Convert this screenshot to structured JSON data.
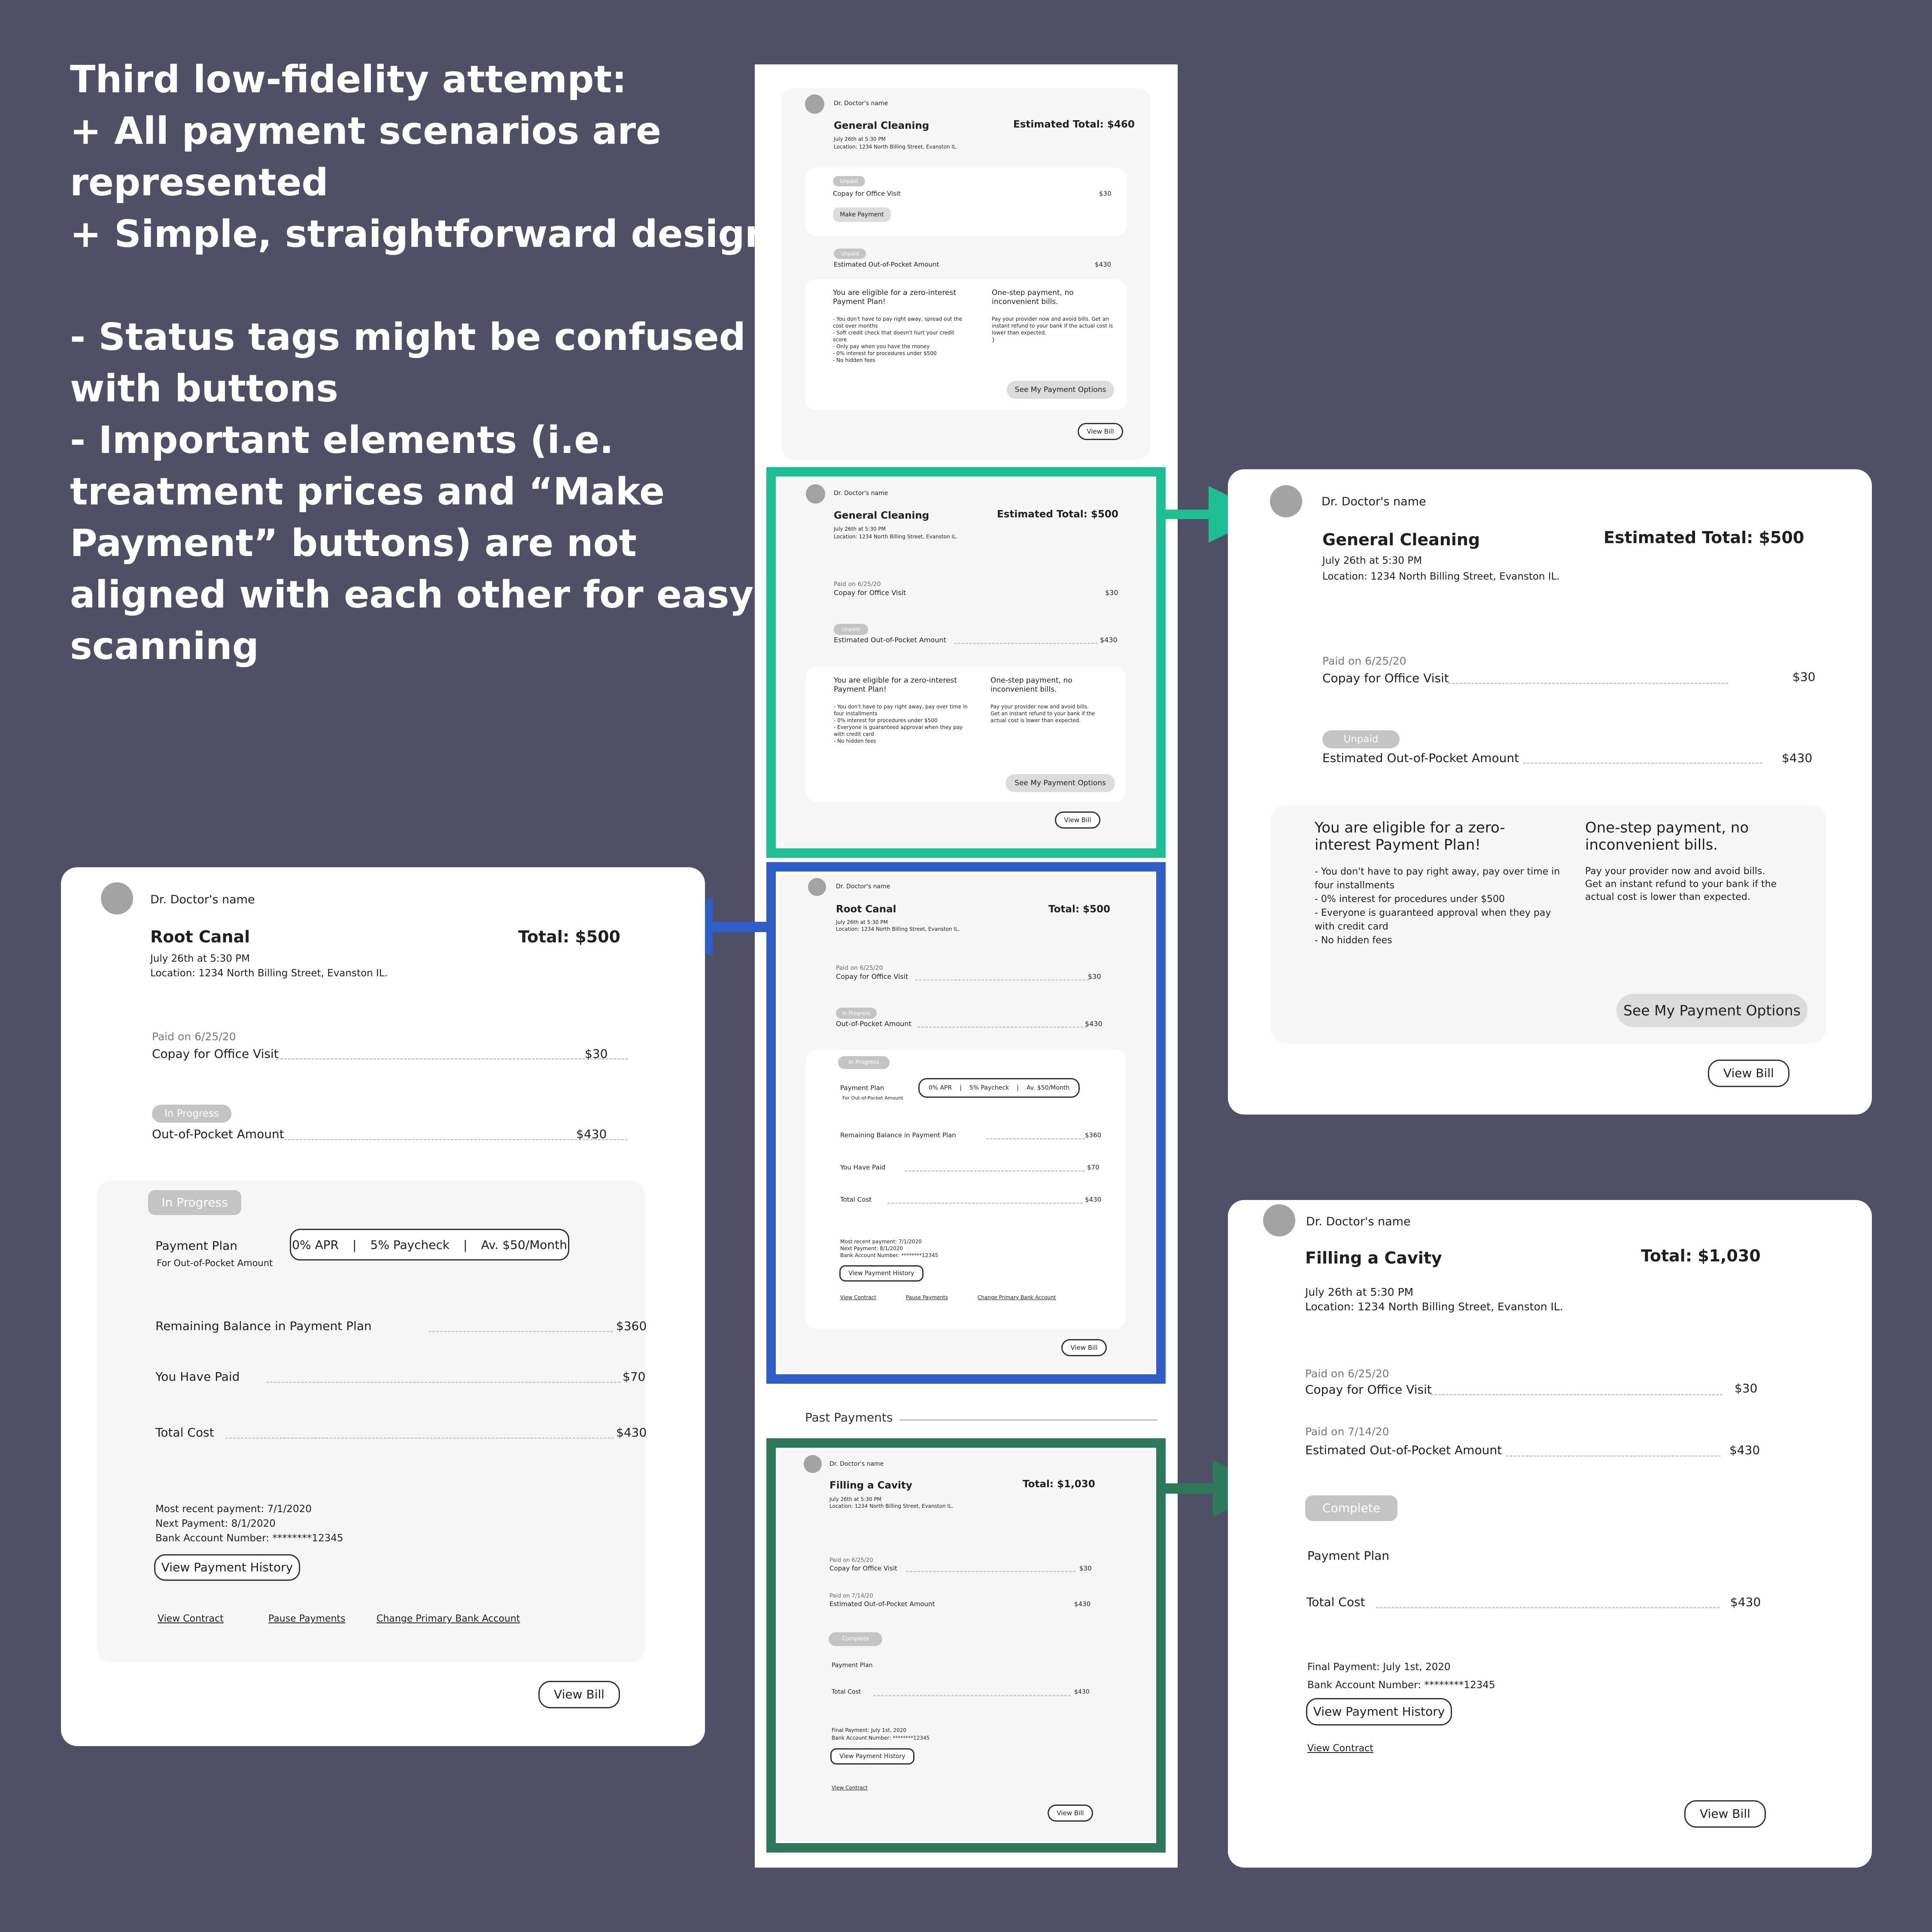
{
  "notes": {
    "lines": [
      "Third low-fidelity attempt:",
      "+ All payment scenarios are",
      "represented",
      "+ Simple, straightforward design",
      "",
      "- Status tags might be confused",
      "with buttons",
      "- Important elements (i.e.",
      "treatment prices and “Make",
      "Payment” buttons) are not",
      "aligned with each other for easy",
      "scanning"
    ]
  },
  "colors": {
    "background": "#4f5065",
    "teal_frame": "#1fbf94",
    "blue_frame": "#2e5fc9",
    "green_frame": "#2d7a5b",
    "tag_grey": "#c4c4c4",
    "avatar_grey": "#a3a3a3"
  },
  "card1": {
    "doctor": "Dr. Doctor's name",
    "procedure": "General Cleaning",
    "total": "Estimated Total: $460",
    "datetime": "July 26th at 5:30 PM",
    "location": "Location: 1234 North Billing Street, Evanston IL.",
    "tag1": "Unpaid",
    "copay_label": "Copay for Office Visit",
    "copay_amount": "$30",
    "make_payment": "Make Payment",
    "tag2": "Unpaid",
    "oop_label": "Estimated Out-of-Pocket Amount",
    "oop_amount": "$430",
    "plan_title": "You are eligible for a zero-interest Payment Plan!",
    "plan_bullets": [
      "- You don't have to pay right away, spread out the",
      "cost over months",
      "- Soft credit check that doesn't hurt your credit",
      "score",
      "- Only pay when you have the money",
      "- 0% interest for procedures under $500",
      "- No hidden fees"
    ],
    "onestep_title": "One-step payment, no inconvenient bills.",
    "onestep_body": [
      "Pay your provider now and avoid bills.  Get an",
      "instant refund to your bank if the actual cost is",
      "lower than expected."
    ],
    "options_button": "See My Payment Options",
    "view_bill": "View Bill"
  },
  "card2": {
    "doctor": "Dr. Doctor's name",
    "procedure": "General Cleaning",
    "total": "Estimated Total: $500",
    "datetime": "July 26th at 5:30 PM",
    "location": "Location: 1234 North Billing Street, Evanston IL.",
    "paid_on": "Paid on 6/25/20",
    "copay_label": "Copay for Office Visit",
    "copay_amount": "$30",
    "tag": "Unpaid",
    "oop_label": "Estimated Out-of-Pocket Amount",
    "oop_amount": "$430",
    "plan_title": "You are eligible for a zero-interest Payment Plan!",
    "plan_bullets": [
      "- You don't have to pay right away, pay over time in",
      "four installments",
      "- 0% interest for procedures under $500",
      "- Everyone is guaranteed approval when they pay",
      "with credit card",
      "- No hidden fees"
    ],
    "onestep_title": "One-step payment, no inconvenient bills.",
    "onestep_body": [
      "Pay your provider now and avoid bills.",
      "Get an instant refund to your bank if the",
      "actual cost is lower than expected."
    ],
    "options_button": "See My Payment Options",
    "view_bill": "View Bill"
  },
  "card3": {
    "doctor": "Dr. Doctor's name",
    "procedure": "Root Canal",
    "total": "Total: $500",
    "datetime": "July 26th at 5:30 PM",
    "location": "Location: 1234 North Billing Street, Evanston IL.",
    "paid_on": "Paid on 6/25/20",
    "copay_label": "Copay for Office Visit",
    "copay_amount": "$30",
    "tag": "In Progress",
    "oop_label": "Out-of-Pocket Amount",
    "oop_amount": "$430",
    "inner_tag": "In Progress",
    "plan_label": "Payment Plan",
    "plan_sub": "For Out-of-Pocket Amount",
    "plan_terms": [
      "0% APR",
      "5% Paycheck",
      "Av. $50/Month"
    ],
    "remaining_label": "Remaining Balance in Payment Plan",
    "remaining_amount": "$360",
    "paid_label": "You Have Paid",
    "paid_amount": "$70",
    "total_label": "Total Cost",
    "total_amount": "$430",
    "recent": "Most recent payment: 7/1/2020",
    "next": "Next Payment: 8/1/2020",
    "account": "Bank Account Number: ********12345",
    "history_button": "View Payment History",
    "links": [
      "View Contract",
      "Pause Payments",
      "Change Primary Bank Account"
    ],
    "view_bill": "View Bill"
  },
  "past_payments": "Past Payments",
  "card4": {
    "doctor": "Dr. Doctor's name",
    "procedure": "Filling a Cavity",
    "total": "Total: $1,030",
    "datetime": "July 26th at 5:30 PM",
    "location": "Location: 1234 North Billing Street, Evanston IL.",
    "paid_on1": "Paid on 6/25/20",
    "copay_label": "Copay for Office Visit",
    "copay_amount": "$30",
    "paid_on2": "Paid on 7/14/20",
    "oop_label": "Estimated Out-of-Pocket Amount",
    "oop_amount": "$430",
    "tag": "Complete",
    "plan_label": "Payment Plan",
    "total_label": "Total Cost",
    "total_amount": "$430",
    "final": "Final Payment: July 1st, 2020",
    "account": "Bank Account Number: ********12345",
    "history_button": "View Payment History",
    "link": "View Contract",
    "view_bill": "View Bill"
  }
}
